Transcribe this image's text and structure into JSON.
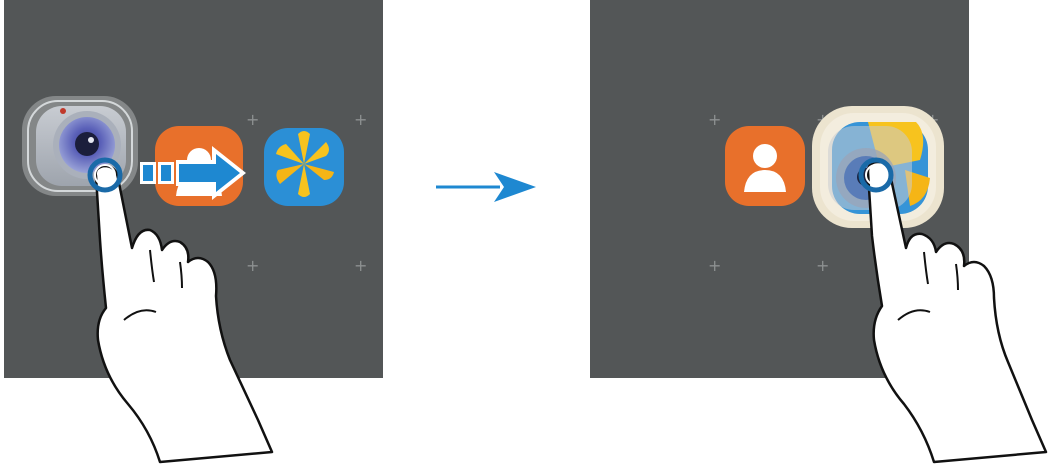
{
  "steps": [
    {
      "id": "before",
      "apps": [
        {
          "name": "camera",
          "icon": "camera-app-icon",
          "state": "dragged"
        },
        {
          "name": "contacts",
          "icon": "contacts-app-icon",
          "state": "behind-drag"
        },
        {
          "name": "gallery",
          "icon": "gallery-app-icon",
          "state": "target"
        }
      ],
      "gesture": "tap-and-hold-then-drag",
      "drag_direction": "right"
    },
    {
      "id": "after",
      "apps": [
        {
          "name": "contacts",
          "icon": "contacts-app-icon",
          "state": "normal"
        },
        {
          "name": "camera",
          "icon": "camera-app-icon",
          "state": "placed-over-gallery"
        }
      ],
      "gesture": "drop"
    }
  ],
  "transition_arrow": "arrow-right-icon",
  "colors": {
    "screen": "#535657",
    "contacts": "#e8702b",
    "gallery_bg": "#2b8fd6",
    "gallery_petals": "#f7c31e",
    "arrow": "#1e88d1",
    "touch_ring": "#1a6aa8"
  }
}
